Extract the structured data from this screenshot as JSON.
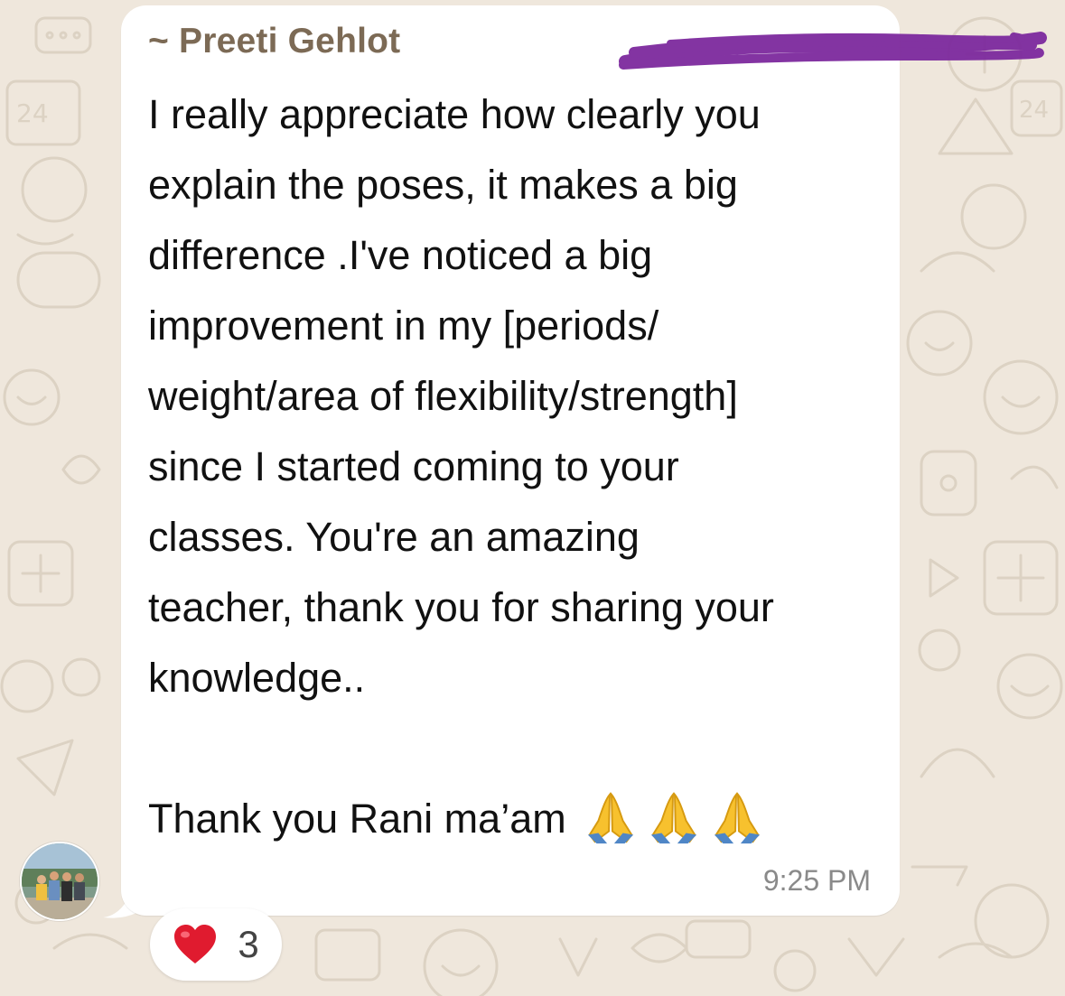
{
  "message": {
    "sender": "~ Preeti Gehlot",
    "lines": [
      "I really appreciate how clearly you",
      "explain the poses, it makes a big",
      "difference .I've noticed a big",
      "improvement in my [periods/",
      "weight/area of flexibility/strength]",
      "since I started coming to your",
      "classes. You're an amazing",
      "teacher, thank you for sharing your",
      "knowledge.."
    ],
    "signoff": "Thank you Rani ma’am",
    "signoff_emoji": [
      "folded-hands-emoji",
      "folded-hands-emoji",
      "folded-hands-emoji"
    ],
    "time": "9:25 PM"
  },
  "reaction": {
    "emoji": "heart-icon",
    "count": "3"
  },
  "colors": {
    "wallpaper": "#efe7dc",
    "bubble": "#ffffff",
    "sender_name": "#7c6a55",
    "redaction": "#7d2a9e",
    "heart": "#e01b2f"
  },
  "avatar": "group-photo-avatar"
}
